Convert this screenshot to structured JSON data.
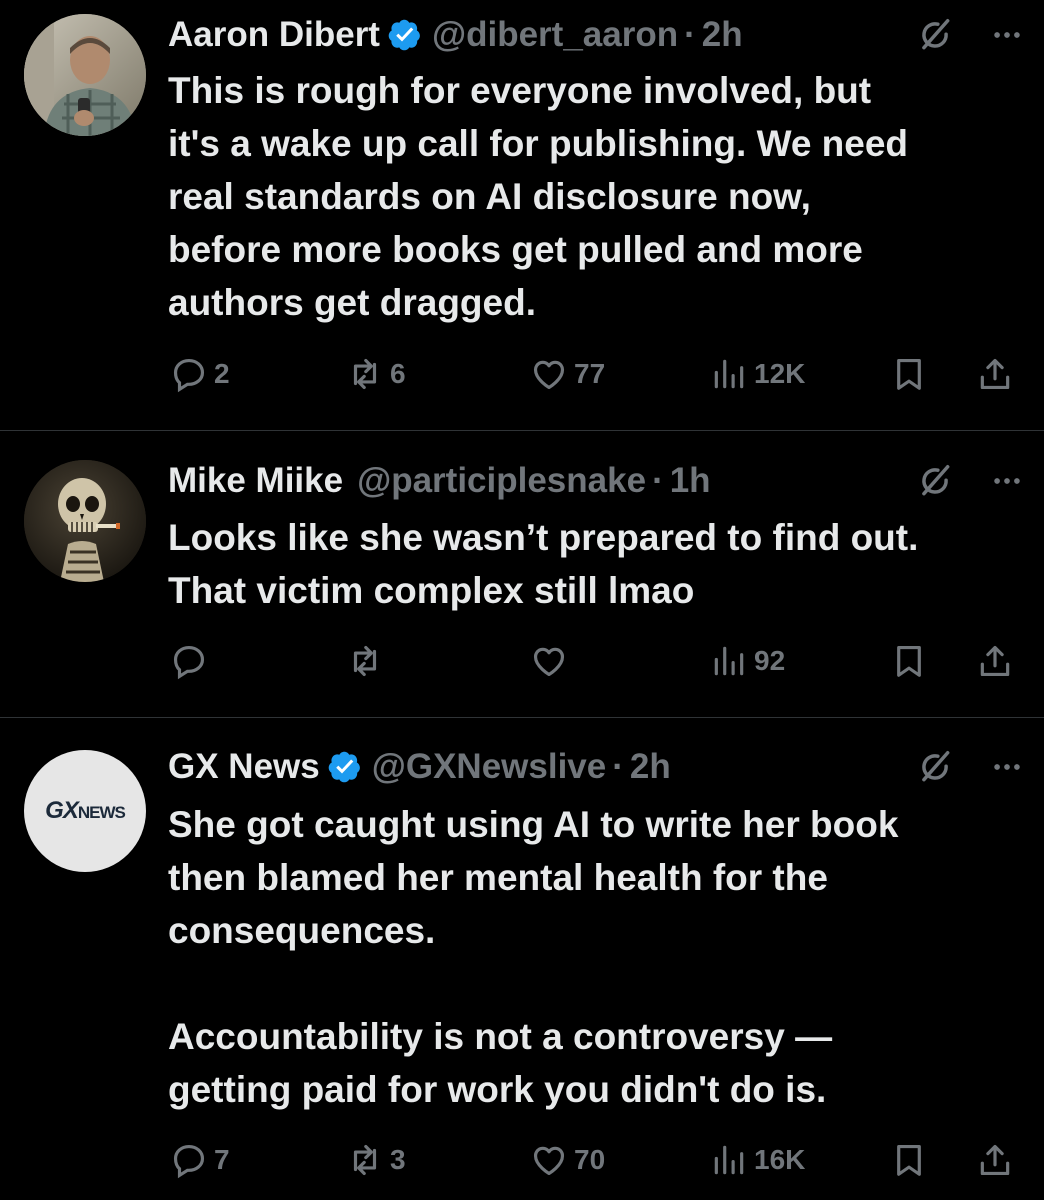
{
  "colors": {
    "background": "#000000",
    "text_primary": "#e7e9ea",
    "text_secondary": "#71767b",
    "divider": "#2f3336",
    "verified_blue": "#1d9bf0"
  },
  "tweets": [
    {
      "name": "Aaron Dibert",
      "verified": true,
      "handle": "@dibert_aaron",
      "separator": "·",
      "time": "2h",
      "text": "This is rough for everyone involved, but\nit's a wake up call for publishing. We need\nreal standards on AI disclosure now,\nbefore more books get pulled and more\nauthors get dragged.",
      "replies": "2",
      "reposts": "6",
      "likes": "77",
      "views": "12K",
      "avatar_icon": "user-photo-avatar"
    },
    {
      "name": "Mike Miike",
      "verified": false,
      "handle": "@participlesnake",
      "separator": "·",
      "time": "1h",
      "text": "Looks like she wasn’t prepared to find out.\nThat victim complex still lmao",
      "replies": "",
      "reposts": "",
      "likes": "",
      "views": "92",
      "avatar_icon": "skull-painting-avatar"
    },
    {
      "name": "GX News",
      "verified": true,
      "handle": "@GXNewslive",
      "separator": "·",
      "time": "2h",
      "text": "She got caught using AI to write her book\nthen blamed her mental health for the\nconsequences.\n\nAccountability is not a controversy —\ngetting paid for work you didn't do is.",
      "replies": "7",
      "reposts": "3",
      "likes": "70",
      "views": "16K",
      "avatar_icon": "gx-news-logo-avatar",
      "avatar_logo_bold": "GX",
      "avatar_logo_rest": "NEWS"
    }
  ]
}
